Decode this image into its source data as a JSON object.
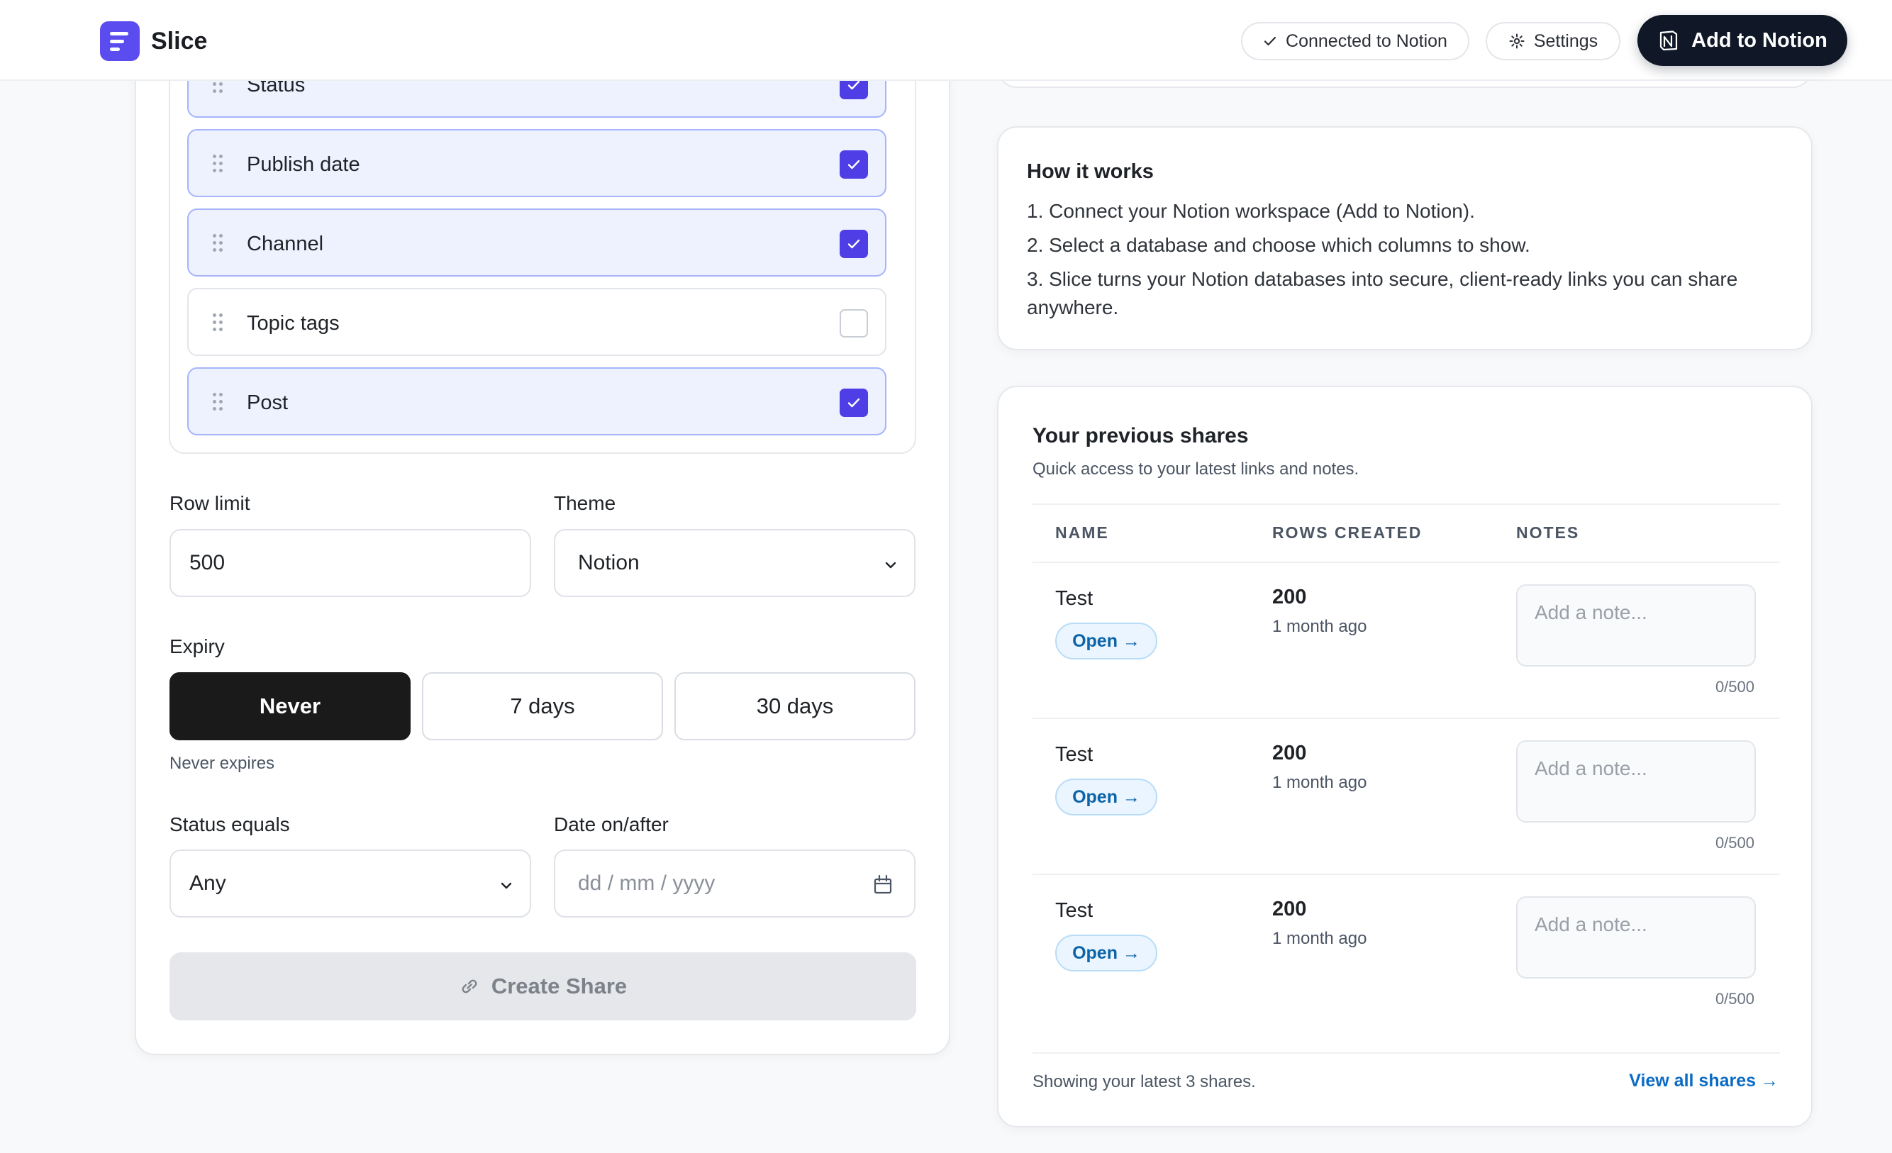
{
  "header": {
    "brand_name": "Slice",
    "connected_label": "Connected to Notion",
    "settings_label": "Settings",
    "add_label": "Add to Notion"
  },
  "columns": {
    "items": [
      {
        "label": "Status",
        "checked": true
      },
      {
        "label": "Publish date",
        "checked": true
      },
      {
        "label": "Channel",
        "checked": true
      },
      {
        "label": "Topic tags",
        "checked": false
      },
      {
        "label": "Post",
        "checked": true
      }
    ]
  },
  "form": {
    "row_limit_label": "Row limit",
    "row_limit_value": "500",
    "theme_label": "Theme",
    "theme_value": "Notion",
    "expiry_label": "Expiry",
    "expiry_options": [
      "Never",
      "7 days",
      "30 days"
    ],
    "expiry_selected": "Never",
    "expiry_hint": "Never expires",
    "status_label": "Status equals",
    "status_value": "Any",
    "date_label": "Date on/after",
    "date_placeholder": "dd / mm / yyyy",
    "create_label": "Create Share"
  },
  "how": {
    "title": "How it works",
    "steps": [
      "1. Connect your Notion workspace (Add to Notion).",
      "2. Select a database and choose which columns to show.",
      "3. Slice turns your Notion databases into secure, client-ready links you can share anywhere."
    ]
  },
  "shares": {
    "title": "Your previous shares",
    "subtitle": "Quick access to your latest links and notes.",
    "headers": [
      "NAME",
      "ROWS CREATED",
      "NOTES"
    ],
    "rows": [
      {
        "name": "Test",
        "open_label": "Open →",
        "rows": "200",
        "created": "1 month ago",
        "note_placeholder": "Add a note...",
        "note_count": "0/500"
      },
      {
        "name": "Test",
        "open_label": "Open →",
        "rows": "200",
        "created": "1 month ago",
        "note_placeholder": "Add a note...",
        "note_count": "0/500"
      },
      {
        "name": "Test",
        "open_label": "Open →",
        "rows": "200",
        "created": "1 month ago",
        "note_placeholder": "Add a note...",
        "note_count": "0/500"
      }
    ],
    "footer": "Showing your latest 3 shares.",
    "view_all": "View all shares →"
  },
  "colors": {
    "accent": "#4f3ee6",
    "brand": "#5b4cf0",
    "link": "#0b6bc4",
    "dark_button": "#101828"
  },
  "icons": {
    "brand": "slice-logo-icon",
    "connected": "check-icon",
    "settings": "gear-icon",
    "notion": "notion-icon",
    "grip": "drag-handle-icon",
    "checkbox": "check-icon",
    "select": "chevron-down-icon",
    "calendar": "calendar-icon",
    "link": "link-icon"
  }
}
